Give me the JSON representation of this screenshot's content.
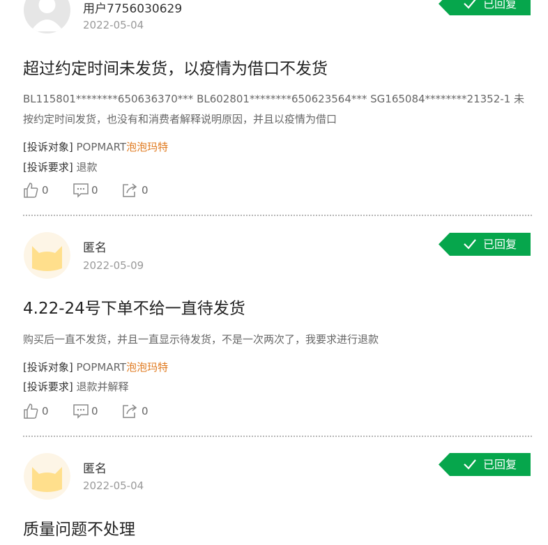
{
  "complaints": [
    {
      "user": "用户7756030629",
      "date": "2022-05-04",
      "status": "已回复",
      "title": "超过约定时间未发货，以疫情为借口不发货",
      "desc": "BL115801********650636370*** BL602801********650623564*** SG165084********21352-1 未按约定时间发货，也没有和消费者解释说明原因，并且以疫情为借口",
      "target_label": "[投诉对象]",
      "target_prefix": "POPMART",
      "target_brand": "泡泡玛特",
      "request_label": "[投诉要求]",
      "request": "退款",
      "likes": "0",
      "comments": "0",
      "shares": "0",
      "avatar": "default-user-icon"
    },
    {
      "user": "匿名",
      "date": "2022-05-09",
      "status": "已回复",
      "title": "4.22-24号下单不给一直待发货",
      "desc": "购买后一直不发货，并且一直显示待发货，不是一次两次了，我要求进行退款",
      "target_label": "[投诉对象]",
      "target_prefix": "POPMART",
      "target_brand": "泡泡玛特",
      "request_label": "[投诉要求]",
      "request": "退款并解释",
      "likes": "0",
      "comments": "0",
      "shares": "0",
      "avatar": "cat-avatar-icon"
    },
    {
      "user": "匿名",
      "date": "2022-05-04",
      "status": "已回复",
      "title": "质量问题不处理",
      "avatar": "cat-avatar-icon"
    }
  ],
  "colors": {
    "badge_green": "#06a64c",
    "brand_orange": "#e07a1f",
    "cat_yellow": "#ffdf8c"
  }
}
